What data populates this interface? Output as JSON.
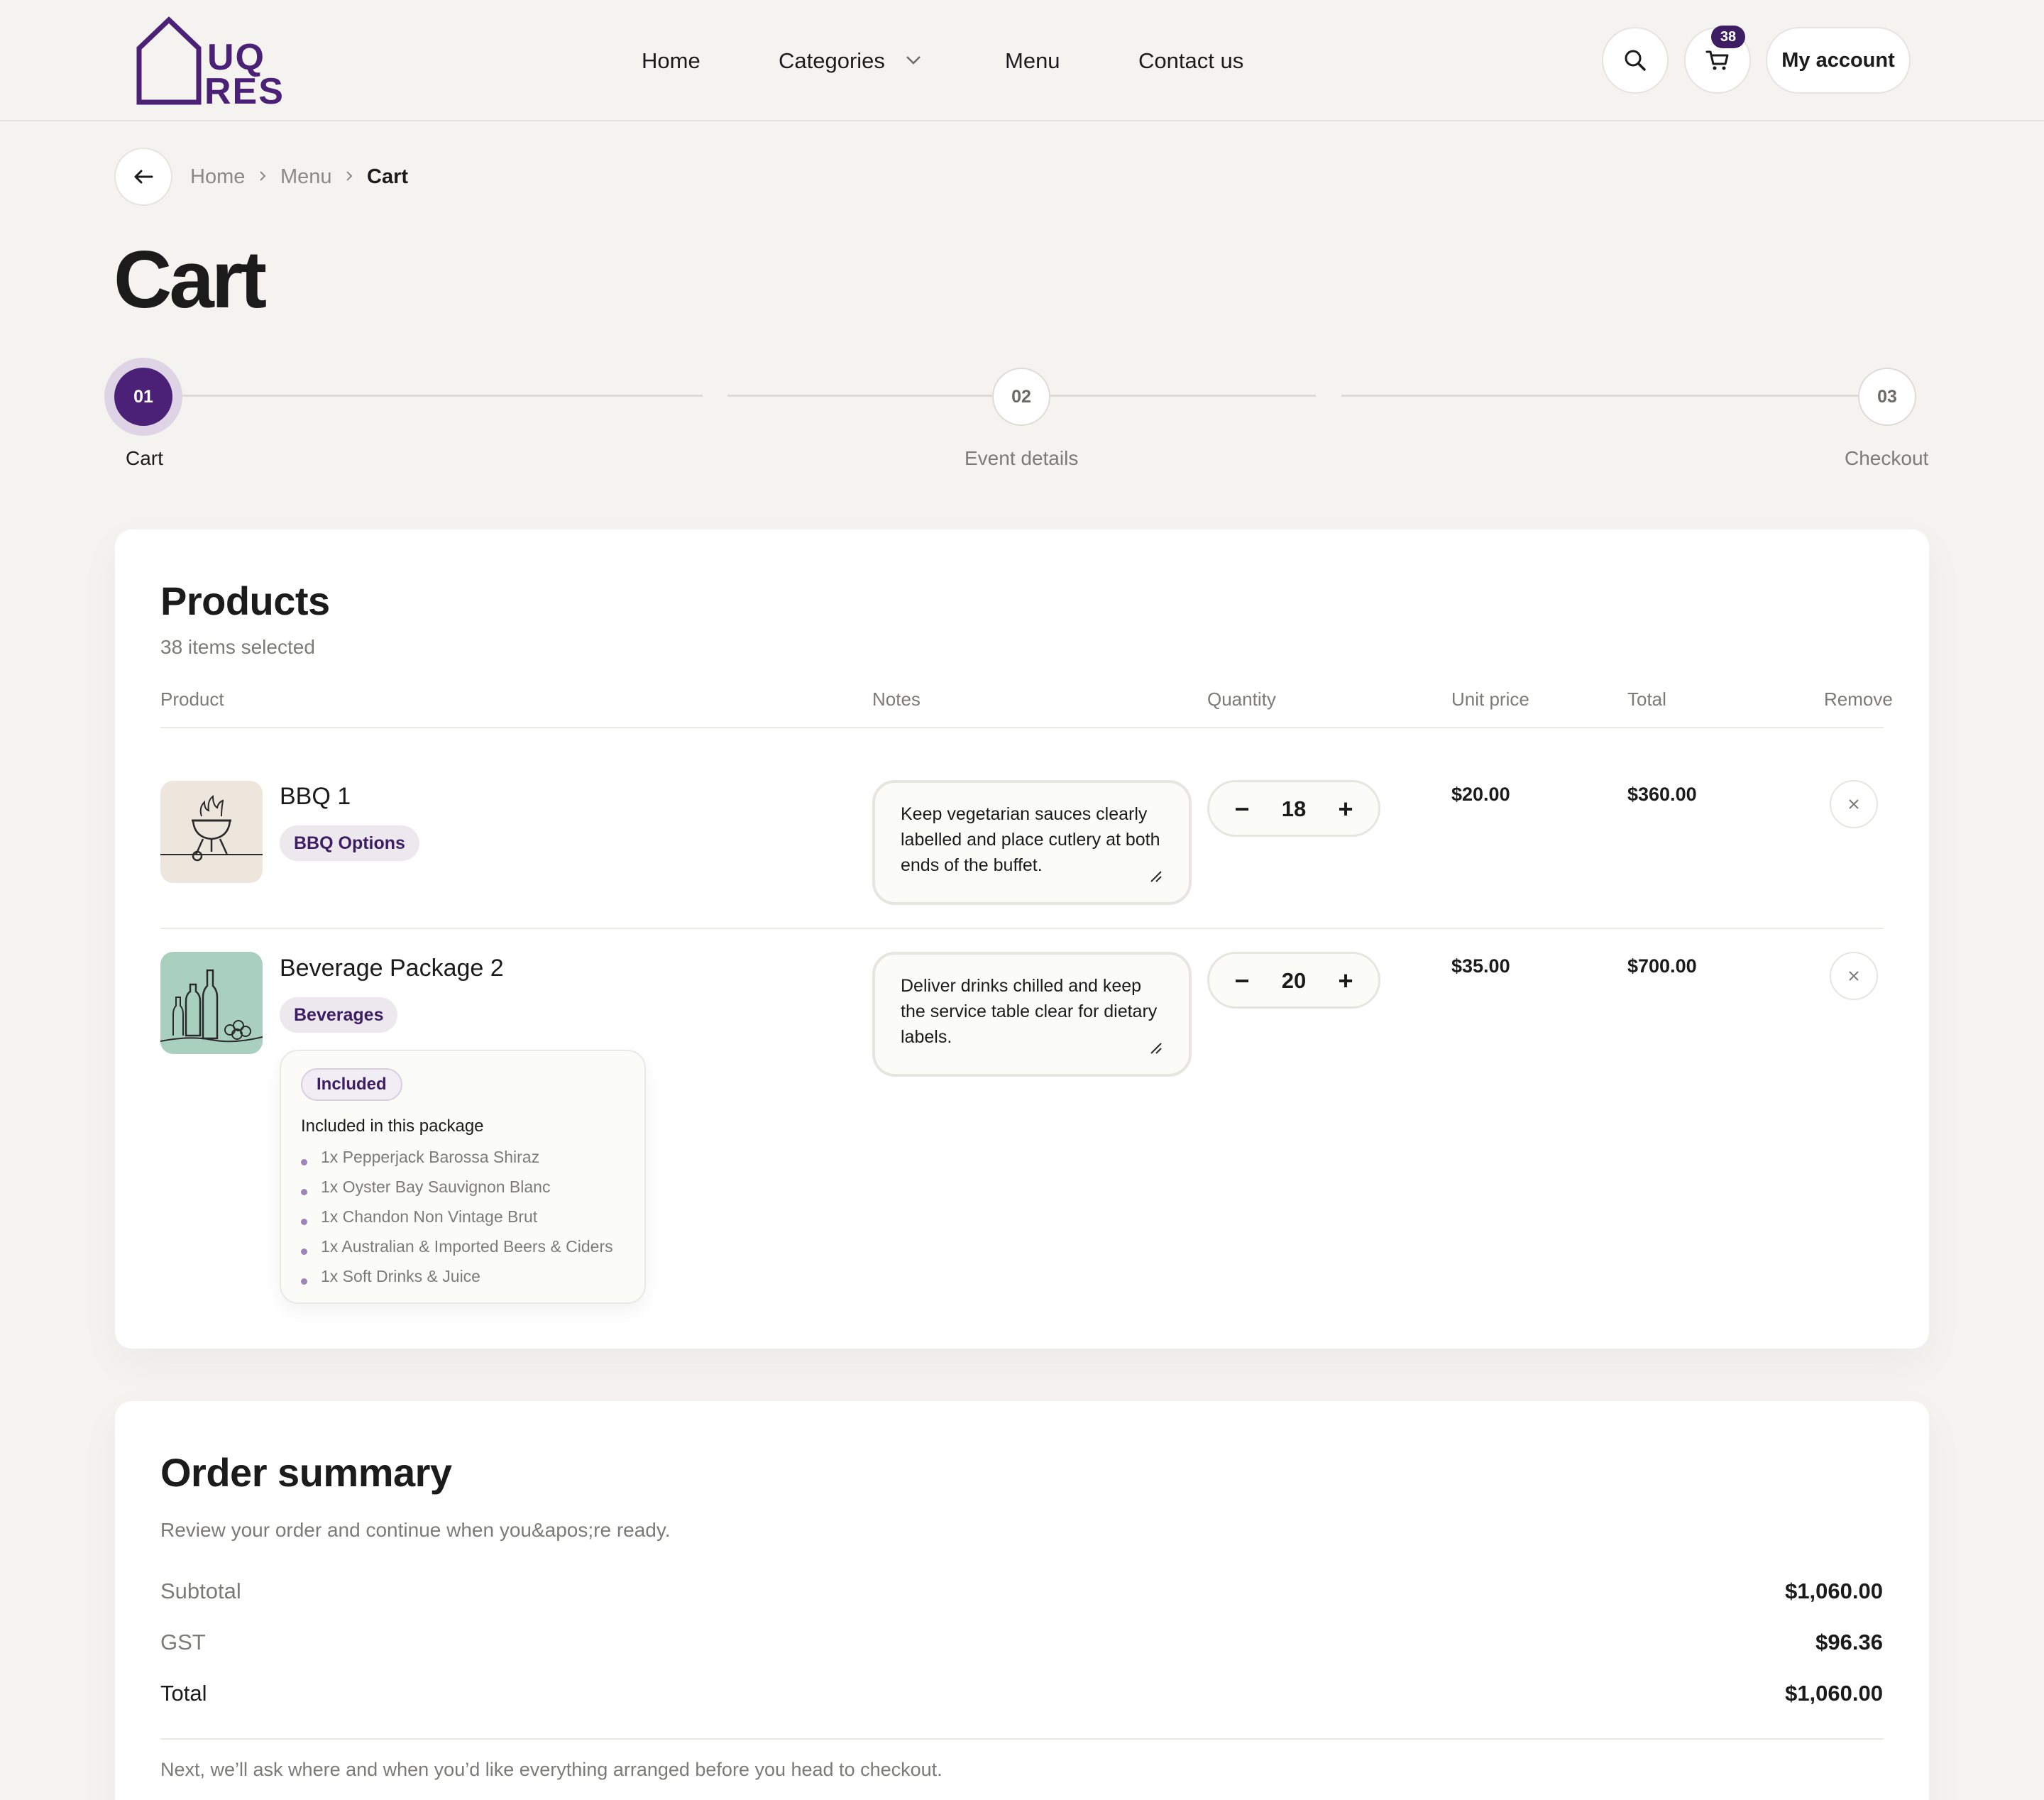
{
  "brand": {
    "logo_line1": "UQ",
    "logo_line2": "RES",
    "accent": "#4a2177",
    "accent_dark": "#3e1d63"
  },
  "nav": {
    "home": "Home",
    "categories": "Categories",
    "menu": "Menu",
    "contact": "Contact us",
    "cart_count": "38",
    "account": "My account",
    "icons": [
      "search-icon",
      "cart-icon",
      "chevron-down-icon"
    ]
  },
  "breadcrumb": {
    "items": [
      "Home",
      "Menu"
    ],
    "current": "Cart"
  },
  "page_title": "Cart",
  "steps": [
    {
      "number": "01",
      "label": "Cart",
      "active": true
    },
    {
      "number": "02",
      "label": "Event details",
      "active": false
    },
    {
      "number": "03",
      "label": "Checkout",
      "active": false
    }
  ],
  "products": {
    "title": "Products",
    "subtitle": "38 items selected",
    "columns": [
      "Product",
      "Notes",
      "Quantity",
      "Unit price",
      "Total",
      "Remove"
    ],
    "rows": [
      {
        "name": "BBQ 1",
        "category": "BBQ Options",
        "notes": "Keep vegetarian sauces clearly labelled and place cutlery at both ends of the buffet.",
        "quantity": "18",
        "unit_price": "$20.00",
        "total": "$360.00",
        "thumb_color": "#ece6dc"
      },
      {
        "name": "Beverage Package 2",
        "category": "Beverages",
        "notes": "Deliver drinks chilled and keep the service table clear for dietary labels.",
        "quantity": "20",
        "unit_price": "$35.00",
        "total": "$700.00",
        "thumb_color": "#a9cfbe",
        "included": {
          "badge": "Included",
          "heading": "Included in this package",
          "items": [
            "1x Pepperjack Barossa Shiraz",
            "1x Oyster Bay Sauvignon Blanc",
            "1x Chandon Non Vintage Brut",
            "1x Australian & Imported Beers & Ciders",
            "1x Soft Drinks & Juice"
          ]
        }
      }
    ],
    "stepper_minus": "−",
    "stepper_plus": "+"
  },
  "summary": {
    "title": "Order summary",
    "subtitle": "Review your order and continue when you&apos;re ready.",
    "subtotal_label": "Subtotal",
    "subtotal": "$1,060.00",
    "gst_label": "GST",
    "gst": "$96.36",
    "total_label": "Total",
    "total": "$1,060.00",
    "footnote": "Next, we’ll ask where and when you’d like everything arranged before you head to checkout."
  }
}
